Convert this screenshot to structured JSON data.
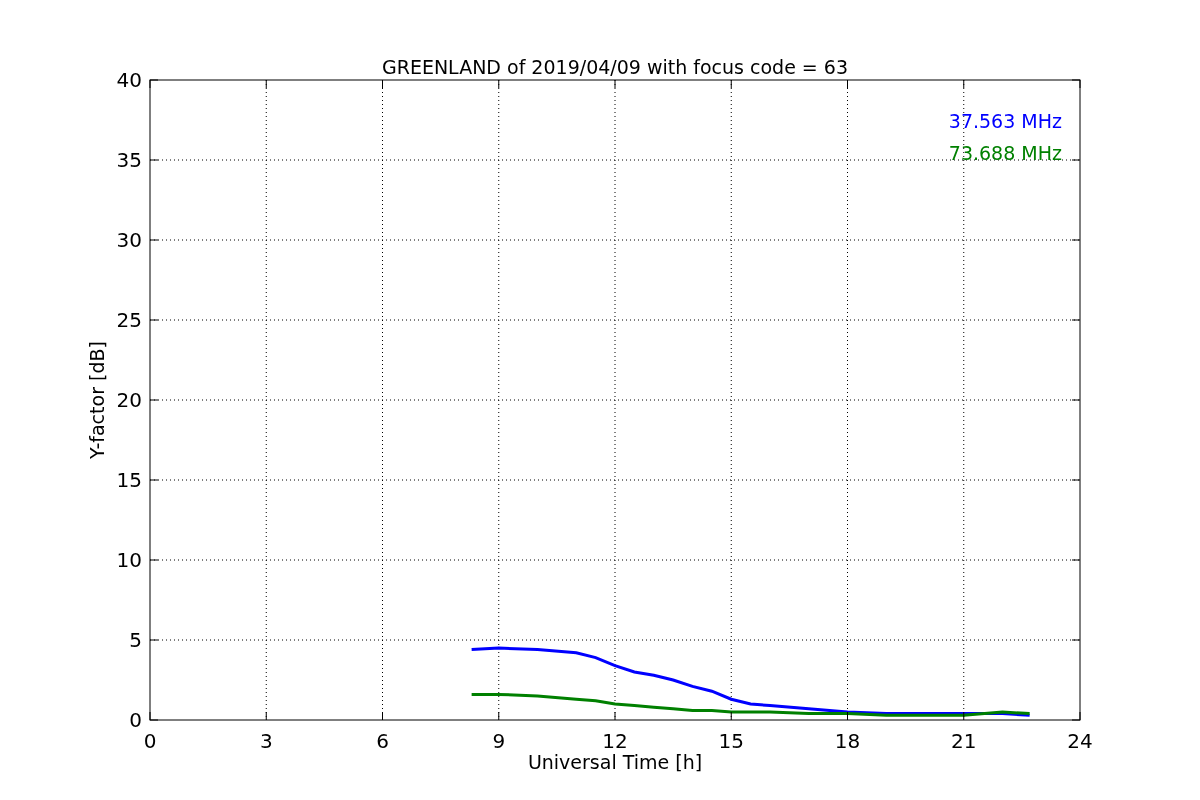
{
  "chart_data": {
    "type": "line",
    "title": "GREENLAND of 2019/04/09 with focus code = 63",
    "xlabel": "Universal Time [h]",
    "ylabel": "Y-factor [dB]",
    "x": [
      8.3,
      9,
      10,
      11,
      11.5,
      12,
      12.5,
      13,
      13.5,
      14,
      14.5,
      15,
      15.5,
      16,
      17,
      18,
      19,
      20,
      21,
      22,
      22.7
    ],
    "series": [
      {
        "name": "37.563 MHz",
        "color": "#0000ff",
        "values": [
          4.4,
          4.5,
          4.4,
          4.2,
          3.9,
          3.4,
          3.0,
          2.8,
          2.5,
          2.1,
          1.8,
          1.3,
          1.0,
          0.9,
          0.7,
          0.5,
          0.4,
          0.4,
          0.4,
          0.4,
          0.3
        ]
      },
      {
        "name": "73.688 MHz",
        "color": "#008000",
        "values": [
          1.6,
          1.6,
          1.5,
          1.3,
          1.2,
          1.0,
          0.9,
          0.8,
          0.7,
          0.6,
          0.6,
          0.5,
          0.5,
          0.5,
          0.4,
          0.4,
          0.3,
          0.3,
          0.3,
          0.5,
          0.4
        ]
      }
    ],
    "grid": true,
    "xlim": [
      0,
      24
    ],
    "ylim": [
      0,
      40
    ],
    "xticks": [
      0,
      3,
      6,
      9,
      12,
      15,
      18,
      21,
      24
    ],
    "yticks": [
      0,
      5,
      10,
      15,
      20,
      25,
      30,
      35,
      40
    ]
  }
}
